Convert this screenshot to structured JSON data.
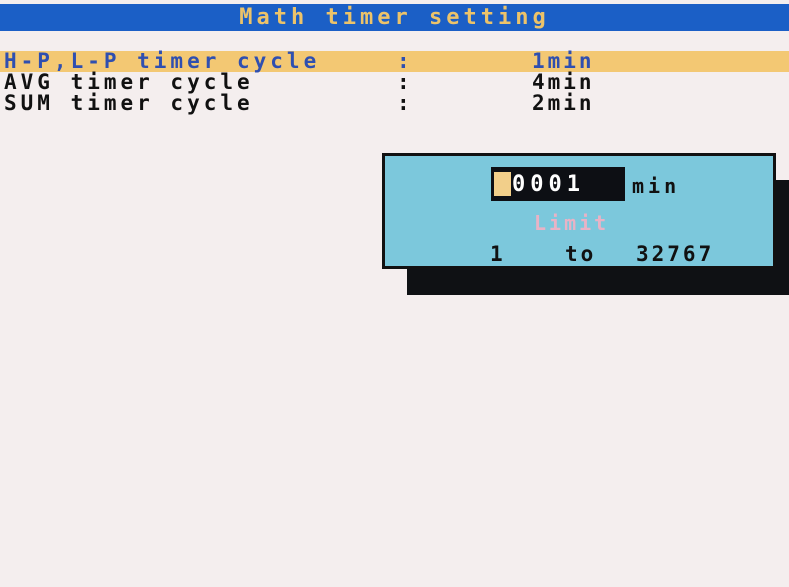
{
  "window": {
    "title": "Math timer setting"
  },
  "settings": [
    {
      "label": "H-P,L-P timer cycle",
      "colon": ":",
      "value": "1min",
      "selected": true
    },
    {
      "label": "AVG timer cycle",
      "colon": ":",
      "value": "4min",
      "selected": false
    },
    {
      "label": "SUM timer cycle",
      "colon": ":",
      "value": "2min",
      "selected": false
    }
  ],
  "dialog": {
    "input_value": "0001",
    "unit": "min",
    "limit_label": "Limit",
    "range_min": "1",
    "range_to": "to",
    "range_max": "32767"
  },
  "colors": {
    "title_bg": "#1b5fc6",
    "title_text": "#ecc36a",
    "selected_row_bg": "#f3c873",
    "dialog_bg": "#7cc8dc",
    "limit_text": "#e8b3c6"
  }
}
